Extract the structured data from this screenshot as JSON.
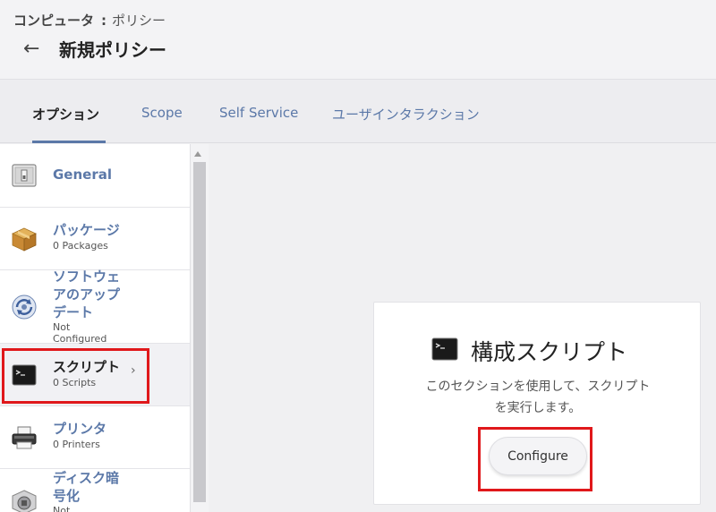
{
  "breadcrumb": {
    "root": "コンピュータ",
    "separator": ":",
    "current": "ポリシー"
  },
  "header": {
    "back_arrow": "←",
    "title": "新規ポリシー"
  },
  "tabs": [
    {
      "label": "オプション",
      "active": true
    },
    {
      "label": "Scope",
      "active": false
    },
    {
      "label": "Self Service",
      "active": false
    },
    {
      "label": "ユーザインタラクション",
      "active": false
    }
  ],
  "sidebar": {
    "items": [
      {
        "label": "General",
        "sub": "",
        "icon": "switch-icon"
      },
      {
        "label": "パッケージ",
        "sub": "0 Packages",
        "icon": "package-box-icon"
      },
      {
        "label_lines": [
          "ソフトウェ",
          "アのアップ",
          "デート"
        ],
        "sub_lines": [
          "Not",
          "Configured"
        ],
        "icon": "software-update-icon"
      },
      {
        "label": "スクリプト",
        "sub": "0 Scripts",
        "icon": "terminal-icon",
        "selected": true,
        "chevron": "›"
      },
      {
        "label": "プリンタ",
        "sub": "0 Printers",
        "icon": "printer-icon"
      },
      {
        "label_lines": [
          "ディスク暗",
          "号化"
        ],
        "sub_lines": [
          "Not"
        ],
        "icon": "disk-encryption-icon"
      }
    ]
  },
  "card": {
    "title": "構成スクリプト",
    "description_lines": [
      "このセクションを使用して、スクリプト",
      "を実行します。"
    ],
    "configure_label": "Configure",
    "icon": "terminal-icon"
  },
  "colors": {
    "accent": "#5b78a8",
    "highlight": "#e0181b"
  }
}
